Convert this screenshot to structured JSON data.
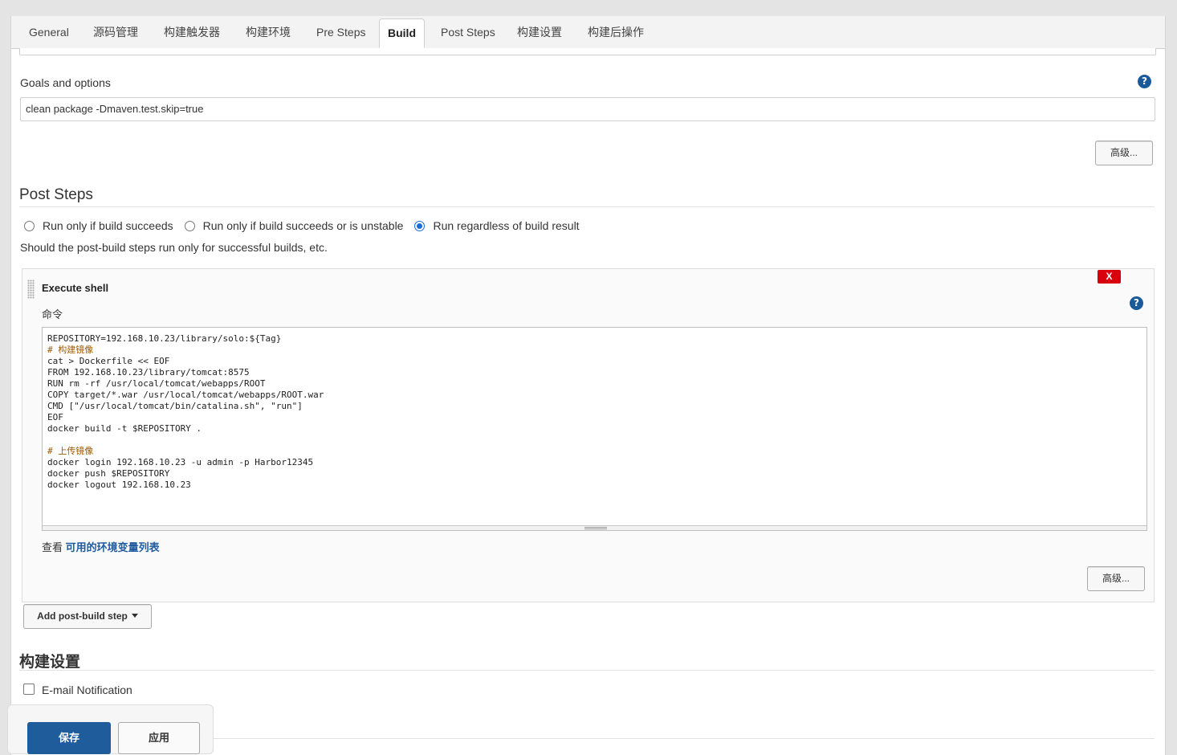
{
  "tabs": [
    {
      "label": "General"
    },
    {
      "label": "源码管理"
    },
    {
      "label": "构建触发器"
    },
    {
      "label": "构建环境"
    },
    {
      "label": "Pre Steps"
    },
    {
      "label": "Build"
    },
    {
      "label": "Post Steps"
    },
    {
      "label": "构建设置"
    },
    {
      "label": "构建后操作"
    }
  ],
  "active_tab": "Build",
  "build": {
    "goals_label": "Goals and options",
    "goals_value": "clean package -Dmaven.test.skip=true",
    "advanced_label": "高级..."
  },
  "post_steps": {
    "title": "Post Steps",
    "radio_options": [
      {
        "label": "Run only if build succeeds",
        "checked": false
      },
      {
        "label": "Run only if build succeeds or is unstable",
        "checked": false
      },
      {
        "label": "Run regardless of build result",
        "checked": true
      }
    ],
    "description": "Should the post-build steps run only for successful builds, etc.",
    "step": {
      "title": "Execute shell",
      "close_label": "X",
      "command_label": "命令",
      "code_lines": [
        "REPOSITORY=192.168.10.23/library/solo:${Tag}",
        "# 构建镜像",
        "cat > Dockerfile << EOF",
        "FROM 192.168.10.23/library/tomcat:8575",
        "RUN rm -rf /usr/local/tomcat/webapps/ROOT",
        "COPY target/*.war /usr/local/tomcat/webapps/ROOT.war",
        "CMD [\"/usr/local/tomcat/bin/catalina.sh\", \"run\"]",
        "EOF",
        "docker build -t $REPOSITORY .",
        "",
        "# 上传镜像",
        "docker login 192.168.10.23 -u admin -p Harbor12345",
        "docker push $REPOSITORY",
        "docker logout 192.168.10.23"
      ],
      "env_prefix": "查看",
      "env_link": "可用的环境变量列表",
      "advanced_label": "高级..."
    },
    "add_step_label": "Add post-build step"
  },
  "build_settings": {
    "title": "构建设置",
    "email_label": "E-mail Notification",
    "email_checked": false
  },
  "footer": {
    "save_label": "保存",
    "apply_label": "应用"
  },
  "colors": {
    "primary": "#1f5c9c",
    "link": "#1d5a9e",
    "danger": "#d9000d",
    "radio_checked": "#1a6dd6"
  },
  "icons": [
    "help-icon",
    "close-icon",
    "drag-handle-icon",
    "caret-down-icon",
    "mouse-cursor-icon"
  ]
}
